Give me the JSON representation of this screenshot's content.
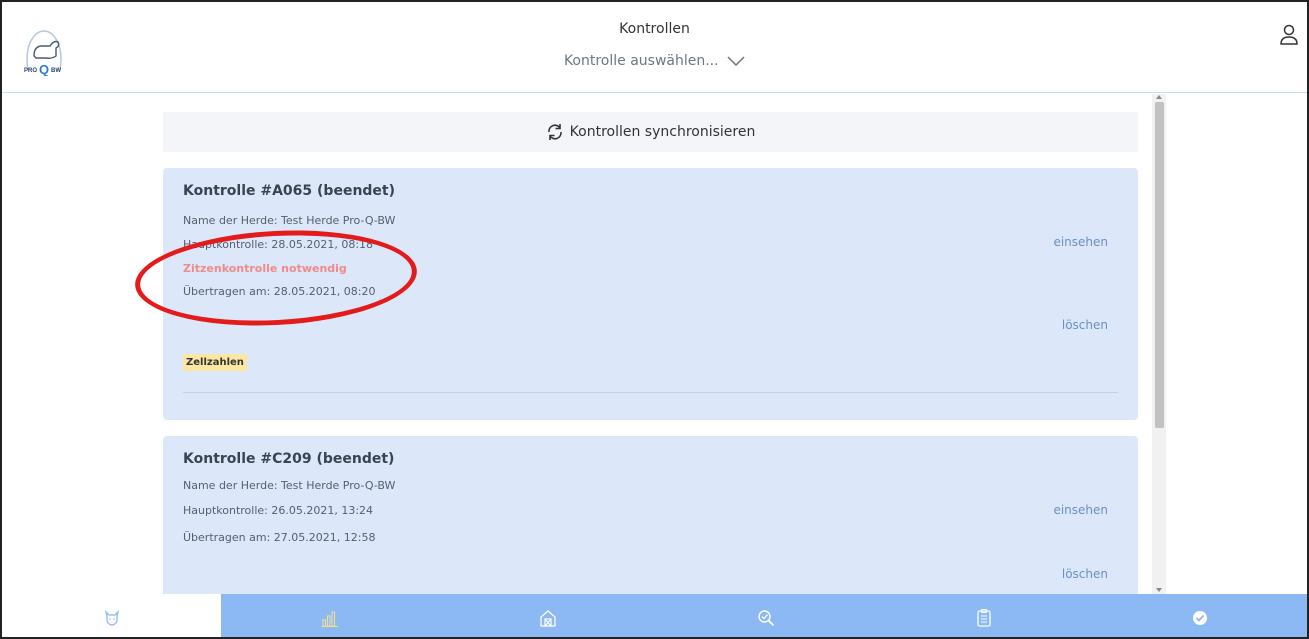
{
  "header": {
    "title": "Kontrollen",
    "select_placeholder": "Kontrolle auswählen...",
    "logo_text": "PRO Q BW"
  },
  "sync": {
    "label": "Kontrollen synchronisieren"
  },
  "cards": [
    {
      "title": "Kontrolle #A065 (beendet)",
      "herd": "Name der Herde: Test Herde Pro-Q-BW",
      "main_control": "Hauptkontrolle: 28.05.2021, 08:18",
      "warning": "Zitzenkontrolle notwendig",
      "transferred": "Übertragen am: 28.05.2021, 08:20",
      "view_label": "einsehen",
      "delete_label": "löschen",
      "badge": "Zellzahlen"
    },
    {
      "title": "Kontrolle #C209 (beendet)",
      "herd": "Name der Herde: Test Herde Pro-Q-BW",
      "main_control": "Hauptkontrolle: 26.05.2021, 13:24",
      "transferred": "Übertragen am: 27.05.2021, 12:58",
      "view_label": "einsehen",
      "delete_label": "löschen"
    }
  ],
  "navbar": {
    "items": [
      {
        "icon": "cow-icon",
        "active": true
      },
      {
        "icon": "bar-chart-icon",
        "active": false
      },
      {
        "icon": "barn-icon",
        "active": false
      },
      {
        "icon": "magnifier-check-icon",
        "active": false
      },
      {
        "icon": "clipboard-icon",
        "active": false
      },
      {
        "icon": "check-circle-icon",
        "active": false
      }
    ]
  },
  "colors": {
    "accent": "#8cb8f4",
    "card_bg": "#dce8f9",
    "warning": "#f08b8b",
    "badge_bg": "#fbe7a2",
    "annotation": "#e31b1b"
  }
}
